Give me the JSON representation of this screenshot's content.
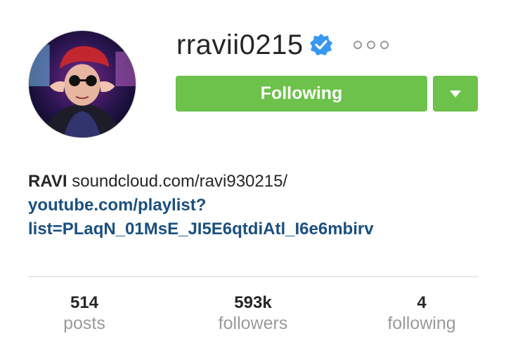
{
  "profile": {
    "username": "rravii0215",
    "verified": true,
    "follow_button_label": "Following",
    "bio_name": "RAVI",
    "bio_text": "soundcloud.com/ravi930215/",
    "bio_link_line1": "youtube.com/playlist?",
    "bio_link_line2": "list=PLaqN_01MsE_JI5E6qtdiAtl_I6e6mbirv"
  },
  "stats": [
    {
      "value": "514",
      "label": "posts"
    },
    {
      "value": "593k",
      "label": "followers"
    },
    {
      "value": "4",
      "label": "following"
    }
  ],
  "colors": {
    "follow_green": "#6cc24a",
    "verified_blue": "#3897f0",
    "link_blue": "#1a4f7e"
  },
  "icons": {
    "verified": "verified-badge-icon",
    "more": "more-options-icon",
    "dropdown": "caret-down-icon"
  }
}
